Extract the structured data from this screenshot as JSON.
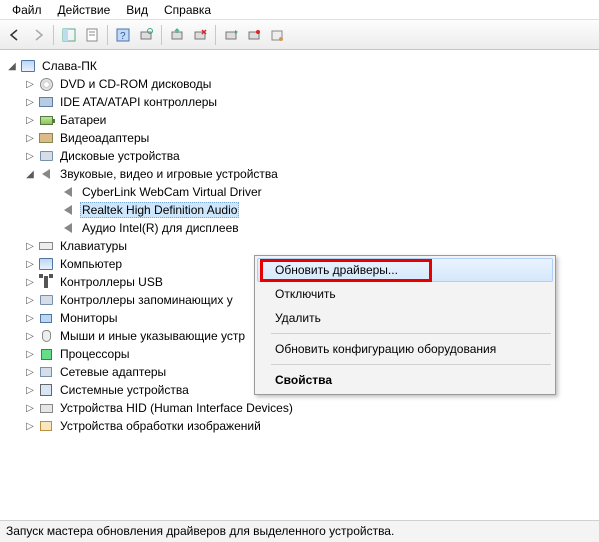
{
  "menu": {
    "file": "Файл",
    "action": "Действие",
    "view": "Вид",
    "help": "Справка"
  },
  "root": "Слава-ПК",
  "cat": {
    "dvd": "DVD и CD-ROM дисководы",
    "ide": "IDE ATA/ATAPI контроллеры",
    "bat": "Батареи",
    "vid": "Видеоадаптеры",
    "disk": "Дисковые устройства",
    "snd": "Звуковые, видео и игровые устройства",
    "kb": "Клавиатуры",
    "comp": "Компьютер",
    "usb": "Контроллеры USB",
    "stor": "Контроллеры запоминающих у",
    "mon": "Мониторы",
    "mouse": "Мыши и иные указывающие устр",
    "cpu": "Процессоры",
    "net": "Сетевые адаптеры",
    "sys": "Системные устройства",
    "hid": "Устройства HID (Human Interface Devices)",
    "img": "Устройства обработки изображений"
  },
  "snd_children": {
    "c0": "CyberLink WebCam Virtual Driver",
    "c1": "Realtek High Definition Audio",
    "c2": "Аудио Intel(R) для дисплеев"
  },
  "ctx": {
    "update": "Обновить драйверы...",
    "disable": "Отключить",
    "remove": "Удалить",
    "scan": "Обновить конфигурацию оборудования",
    "props": "Свойства"
  },
  "status": "Запуск мастера обновления драйверов для выделенного устройства."
}
